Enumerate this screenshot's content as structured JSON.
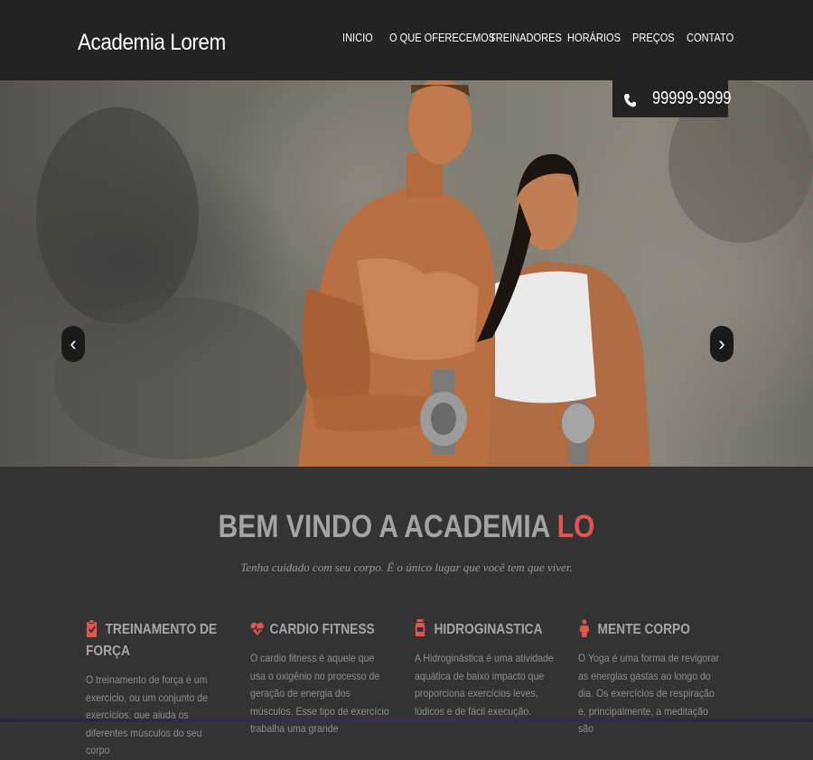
{
  "header": {
    "logo": "Academia Lorem",
    "nav": [
      "INICIO",
      "O QUE OFERECEMOS",
      "TREINADORES",
      "HORÁRIOS",
      "PREÇOS",
      "CONTATO"
    ]
  },
  "hero": {
    "phone": "99999-9999",
    "prev_arrow": "‹",
    "next_arrow": "›",
    "icons": {
      "phone": "phone-icon"
    }
  },
  "welcome": {
    "title_main": "BEM VINDO A ACADEMIA ",
    "title_accent": "LO",
    "tagline": "Tenha cuidado com seu corpo. É o único lugar que você tem que viver."
  },
  "features": [
    {
      "icon": "clipboard-icon",
      "title": "TREINAMENTO DE FORÇA",
      "text": "O treinamento de força é um exercício, ou um conjunto de exercícios, que ajuda os diferentes músculos do seu corpo"
    },
    {
      "icon": "heart-pulse-icon",
      "title": "CARDIO FITNESS",
      "text": "O cardio fitness é aquele que usa o oxigênio no processo de geração de energia dos músculos. Esse tipo de exercício trabalha uma grande"
    },
    {
      "icon": "water-bottle-icon",
      "title": "HIDROGINASTICA",
      "text": "A Hidroginástica é uma atividade aquática de baixo impacto que proporciona exercícios leves, lúdicos e de fácil execução."
    },
    {
      "icon": "person-icon",
      "title": "MENTE CORPO",
      "text": "O Yoga é uma forma de revigorar as energias gastas ao longo do dia. Os exercícios de respiração e, principalmente, a meditação são"
    }
  ],
  "colors": {
    "accent": "#e2554e",
    "header_bg": "#232323",
    "page_bg": "#333333"
  }
}
